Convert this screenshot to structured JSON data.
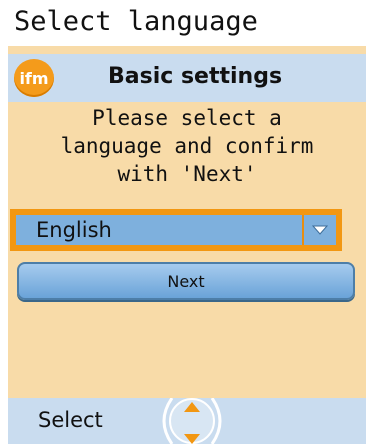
{
  "screen": {
    "title": "Select language"
  },
  "header": {
    "logo_text": "ifm",
    "title": "Basic settings"
  },
  "instruction": "Please select a\nlanguage and confirm\nwith 'Next'",
  "language_select": {
    "selected": "English",
    "icon": "chevron-down-icon"
  },
  "buttons": {
    "next_label": "Next"
  },
  "footer": {
    "left_label": "Select",
    "nav_icon": "up-down-navigation-icon"
  },
  "colors": {
    "panel_bg": "#f8dba8",
    "bar_bg": "#c9dcef",
    "accent_orange": "#f29712",
    "select_blue": "#7eb0dd",
    "button_blue": "#6aa3d8"
  }
}
